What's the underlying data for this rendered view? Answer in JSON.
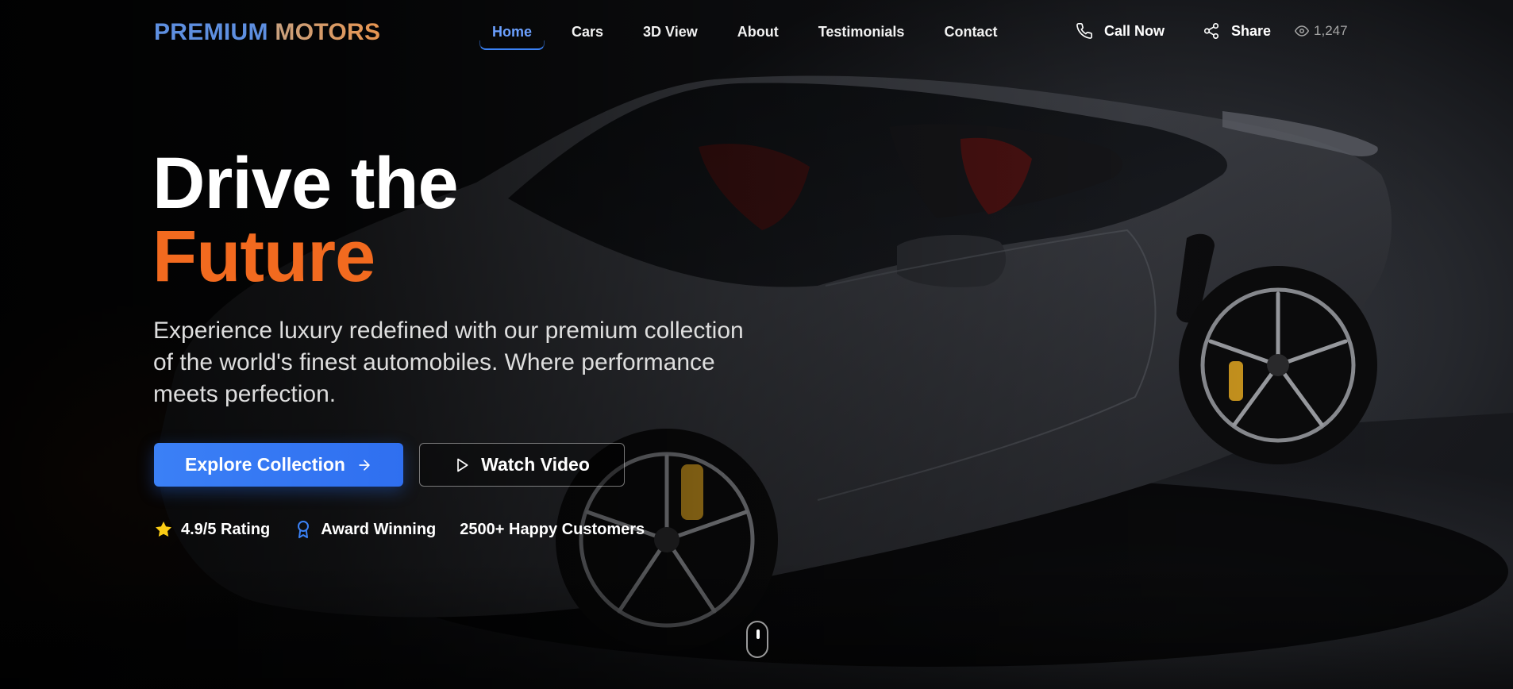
{
  "brand": {
    "word1": "PREMIUM",
    "word2": "MOTORS"
  },
  "nav": {
    "items": [
      {
        "label": "Home",
        "active": true
      },
      {
        "label": "Cars",
        "active": false
      },
      {
        "label": "3D View",
        "active": false
      },
      {
        "label": "About",
        "active": false
      },
      {
        "label": "Testimonials",
        "active": false
      },
      {
        "label": "Contact",
        "active": false
      }
    ],
    "call_label": "Call Now",
    "call_icon": "phone-icon",
    "share_label": "Share",
    "share_icon": "share-icon",
    "views_count": "1,247",
    "views_icon": "eye-icon"
  },
  "hero": {
    "headline_line1": "Drive the",
    "headline_line2": "Future",
    "subtitle": "Experience luxury redefined with our premium collection of the world's finest automobiles. Where performance meets perfection.",
    "primary_button": "Explore Collection",
    "primary_icon": "arrow-right-icon",
    "secondary_button": "Watch Video",
    "secondary_icon": "play-icon",
    "stats": [
      {
        "icon": "star-icon",
        "label": "4.9/5 Rating"
      },
      {
        "icon": "award-icon",
        "label": "Award Winning"
      },
      {
        "icon": "",
        "label": "2500+ Happy Customers"
      }
    ],
    "scroll_icon": "mouse-scroll-icon"
  },
  "colors": {
    "accent_blue": "#3b82f6",
    "accent_orange": "#f26a1f",
    "star_yellow": "#facc15",
    "background": "#050505"
  }
}
